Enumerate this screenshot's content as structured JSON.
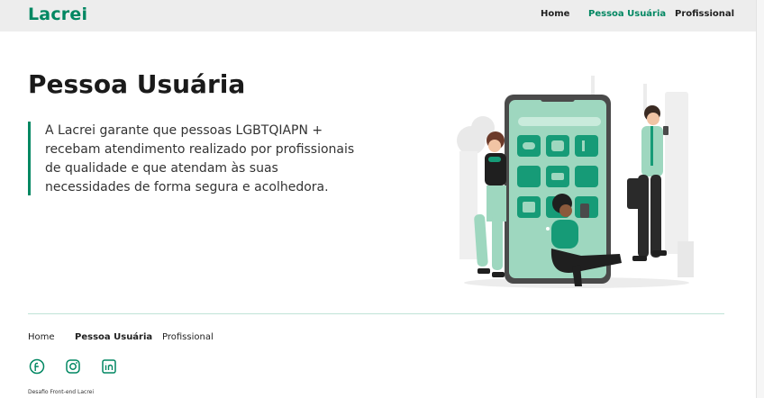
{
  "header": {
    "logo": "Lacrei",
    "nav": [
      {
        "label": "Home"
      },
      {
        "label": "Pessoa Usuária",
        "active": true
      },
      {
        "label": "Profissional"
      }
    ]
  },
  "main": {
    "title": "Pessoa Usuária",
    "description": "A Lacrei garante que pessoas LGBTQIAPN + recebam atendimento realizado por profissionais de qualidade e que atendam às suas necessidades de forma segura e acolhedora."
  },
  "footer": {
    "nav": [
      {
        "label": "Home"
      },
      {
        "label": "Pessoa Usuária"
      },
      {
        "label": "Profissional"
      }
    ],
    "social": [
      "facebook-icon",
      "instagram-icon",
      "linkedin-icon"
    ],
    "credit": "Desafio Front-end Lacrei"
  },
  "colors": {
    "brand": "#018762",
    "header_bg": "#EDEDED",
    "accent_light": "#9ED7BF"
  }
}
